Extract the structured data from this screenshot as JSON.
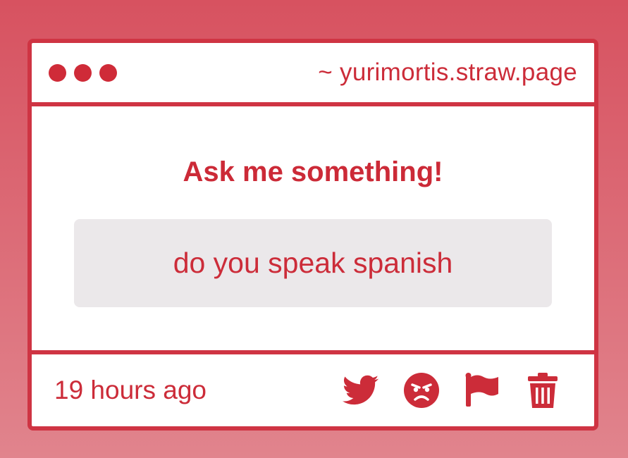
{
  "window": {
    "controls": [
      "dot",
      "dot",
      "dot"
    ],
    "url": "~ yurimortis.straw.page"
  },
  "main": {
    "heading": "Ask me something!",
    "question": "do you speak spanish"
  },
  "footer": {
    "timestamp": "19 hours ago",
    "actions": [
      {
        "name": "twitter-icon",
        "action": "share on twitter"
      },
      {
        "name": "angry-face-icon",
        "action": "react"
      },
      {
        "name": "flag-icon",
        "action": "report"
      },
      {
        "name": "trash-icon",
        "action": "delete"
      }
    ]
  },
  "colors": {
    "accent": "#cf3443",
    "text": "#cc2c39",
    "question_bg": "#ebe8ea",
    "background_top": "#d75260",
    "background_bottom": "#e1848d"
  }
}
